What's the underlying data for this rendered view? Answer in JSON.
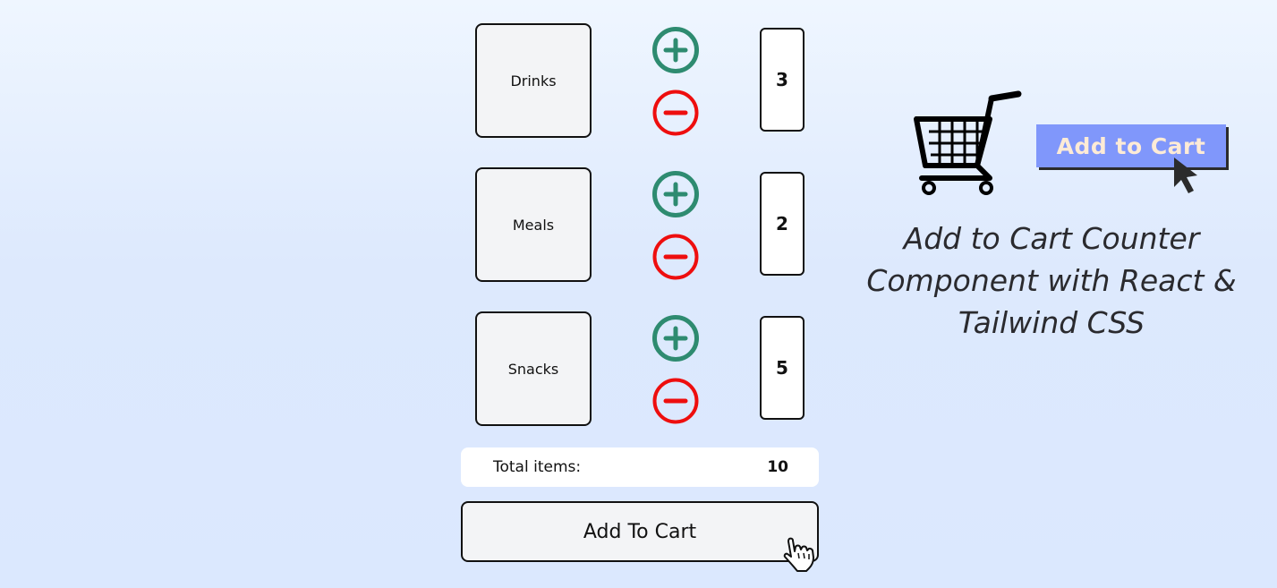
{
  "items": [
    {
      "name": "Drinks",
      "count": "3"
    },
    {
      "name": "Meals",
      "count": "2"
    },
    {
      "name": "Snacks",
      "count": "5"
    }
  ],
  "icons": {
    "increment": "plus-circle-icon",
    "decrement": "minus-circle-icon"
  },
  "colors": {
    "increment": "#2e8b70",
    "decrement": "#ee0e0e",
    "promo_button": "#8097fb"
  },
  "total": {
    "label": "Total items:",
    "value": "10"
  },
  "cart_button": {
    "label": "Add To Cart"
  },
  "promo": {
    "button_label": "Add to Cart",
    "title": "Add to Cart Counter Component with React & Tailwind CSS"
  }
}
